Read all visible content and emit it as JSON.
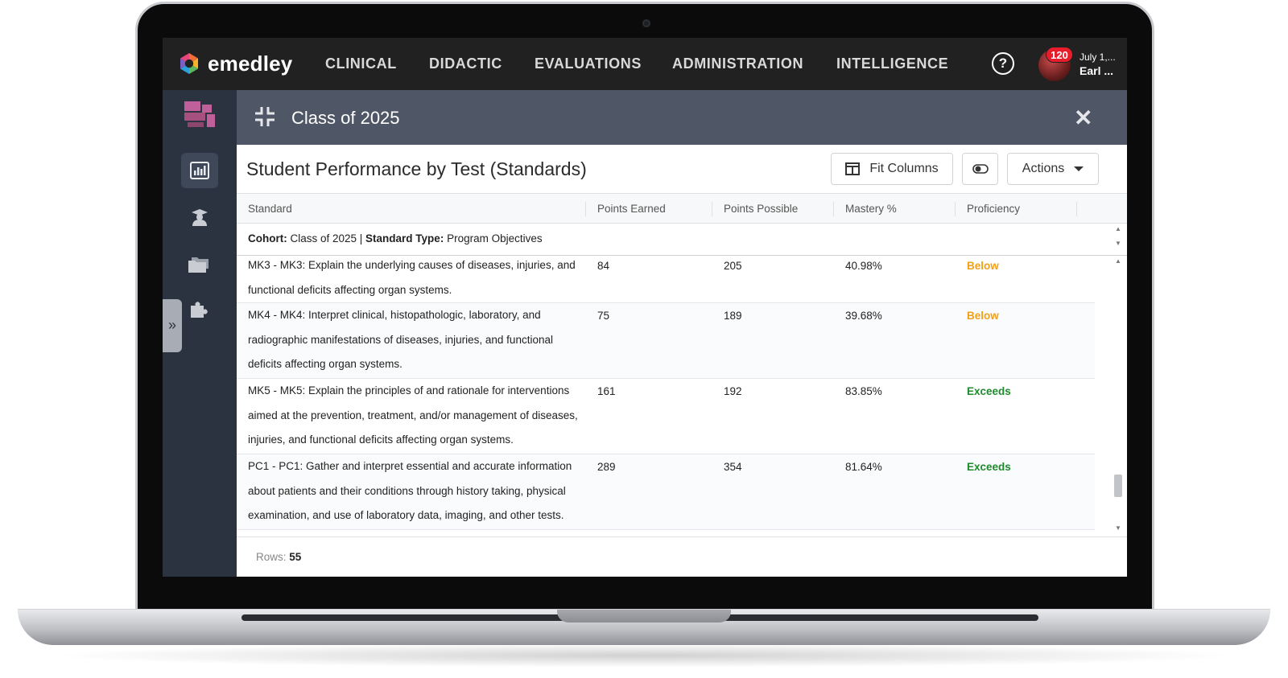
{
  "brand": {
    "name": "emedley"
  },
  "nav": {
    "items": [
      {
        "label": "CLINICAL"
      },
      {
        "label": "DIDACTIC"
      },
      {
        "label": "EVALUATIONS"
      },
      {
        "label": "ADMINISTRATION"
      },
      {
        "label": "INTELLIGENCE"
      }
    ]
  },
  "user": {
    "notifications": "120",
    "date": "July 1,...",
    "name": "Earl ..."
  },
  "panel": {
    "title": "Class of 2025"
  },
  "report": {
    "title": "Student Performance by Test (Standards)",
    "fit_columns_label": "Fit Columns",
    "actions_label": "Actions"
  },
  "grid": {
    "columns": [
      "Standard",
      "Points Earned",
      "Points Possible",
      "Mastery %",
      "Proficiency"
    ],
    "group": {
      "cohort_label": "Cohort:",
      "cohort_value": " Class of 2025 | ",
      "type_label": "Standard Type:",
      "type_value": " Program Objectives"
    },
    "rows": [
      {
        "standard": "MK3 - MK3: Explain the underlying causes of diseases, injuries, and functional deficits affecting organ systems.",
        "earned": "84",
        "possible": "205",
        "mastery": "40.98%",
        "proficiency": "Below"
      },
      {
        "standard": "MK4 - MK4: Interpret clinical, histopathologic, laboratory, and radiographic manifestations of diseases, injuries, and functional deficits affecting organ systems.",
        "earned": "75",
        "possible": "189",
        "mastery": "39.68%",
        "proficiency": "Below"
      },
      {
        "standard": "MK5 - MK5: Explain the principles of and rationale for interventions aimed at the prevention, treatment, and/or management of diseases, injuries, and functional deficits affecting organ systems.",
        "earned": "161",
        "possible": "192",
        "mastery": "83.85%",
        "proficiency": "Exceeds"
      },
      {
        "standard": "PC1 - PC1: Gather and interpret essential and accurate information about patients and their conditions through history taking, physical examination, and use of laboratory data, imaging, and other tests.",
        "earned": "289",
        "possible": "354",
        "mastery": "81.64%",
        "proficiency": "Exceeds"
      }
    ],
    "footer_label": "Rows:",
    "row_count": "55"
  },
  "colors": {
    "below": "#f0a01a",
    "exceeds": "#1e8a2e",
    "topnav": "#212121",
    "sidebar": "#2b3341",
    "panel_header": "#4f5665"
  },
  "icons": [
    "help-icon",
    "chart-icon",
    "graduate-icon",
    "folders-icon",
    "puzzle-icon",
    "compress-icon",
    "close-icon",
    "columns-icon",
    "toggle-icon",
    "caret-down-icon",
    "double-chevron-right-icon"
  ]
}
